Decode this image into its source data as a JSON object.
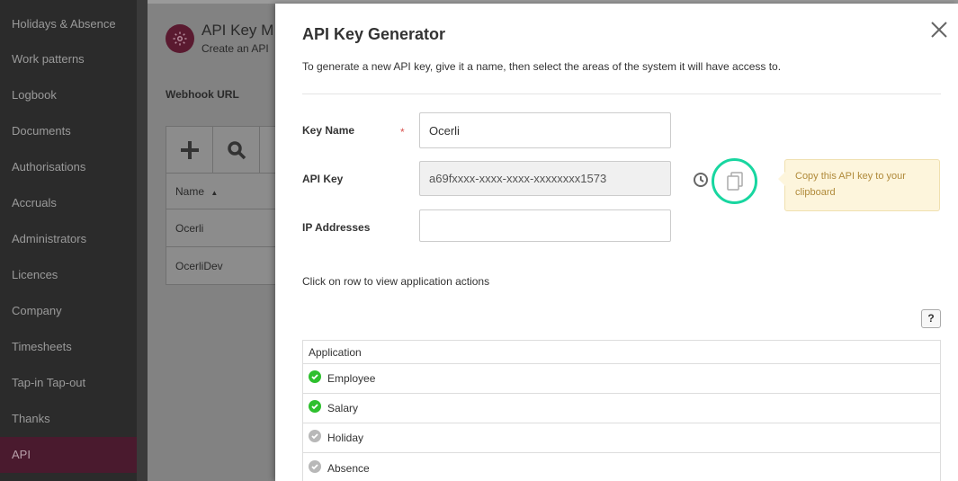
{
  "sidebar": {
    "items": [
      {
        "label": "Holidays & Absence"
      },
      {
        "label": "Work patterns"
      },
      {
        "label": "Logbook"
      },
      {
        "label": "Documents"
      },
      {
        "label": "Authorisations"
      },
      {
        "label": "Accruals"
      },
      {
        "label": "Administrators"
      },
      {
        "label": "Licences"
      },
      {
        "label": "Company"
      },
      {
        "label": "Timesheets"
      },
      {
        "label": "Tap-in Tap-out"
      },
      {
        "label": "Thanks"
      },
      {
        "label": "API",
        "active": true
      }
    ]
  },
  "background": {
    "title": "API Key M",
    "subtitle": "Create an API",
    "webhook_label": "Webhook URL",
    "table": {
      "column": "Name",
      "rows": [
        "Ocerli",
        "OcerliDev"
      ]
    }
  },
  "modal": {
    "title": "API Key Generator",
    "intro": "To generate a new API key, give it a name, then select the areas of the system it will have access to.",
    "key_name_label": "Key Name",
    "required_mark": "*",
    "key_name_value": "Ocerli",
    "api_key_label": "API Key",
    "api_key_value": "a69fxxxx-xxxx-xxxx-xxxxxxxx1573",
    "ip_label": "IP Addresses",
    "ip_value": "",
    "tooltip": "Copy this API key to your clipboard",
    "click_row_text": "Click on row to view application actions",
    "help_label": "?",
    "apps_header": "Application",
    "apps": [
      {
        "label": "Employee",
        "enabled": true
      },
      {
        "label": "Salary",
        "enabled": true
      },
      {
        "label": "Holiday",
        "enabled": false
      },
      {
        "label": "Absence",
        "enabled": false
      }
    ]
  },
  "colors": {
    "accent_active": "#4a1a2e",
    "copy_highlight": "#18d6a0",
    "enabled": "#2ec02e",
    "disabled": "#b8b8b8"
  }
}
